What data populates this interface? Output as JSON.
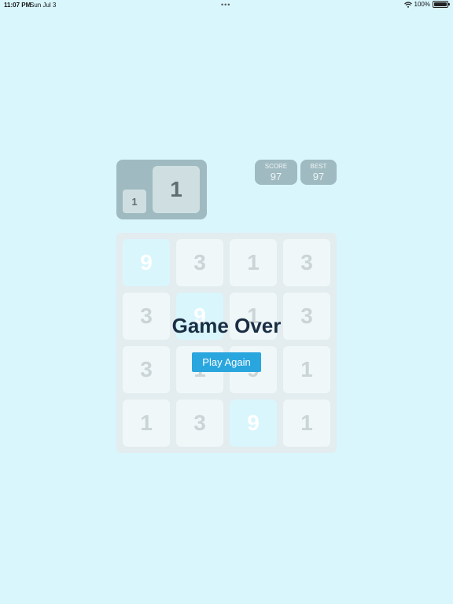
{
  "status_bar": {
    "time": "11:07 PM",
    "date": "Sun Jul 3",
    "battery": "100%",
    "multitask_dots": "•••"
  },
  "next_tiles": {
    "small": "1",
    "big": "1"
  },
  "score": {
    "label": "SCORE",
    "value": "97"
  },
  "best": {
    "label": "BEST",
    "value": "97"
  },
  "board": {
    "rows": [
      [
        {
          "v": "9",
          "hi": true
        },
        {
          "v": "3",
          "hi": false
        },
        {
          "v": "1",
          "hi": false
        },
        {
          "v": "3",
          "hi": false
        }
      ],
      [
        {
          "v": "3",
          "hi": false
        },
        {
          "v": "9",
          "hi": true
        },
        {
          "v": "1",
          "hi": false
        },
        {
          "v": "3",
          "hi": false
        }
      ],
      [
        {
          "v": "3",
          "hi": false
        },
        {
          "v": "1",
          "hi": false
        },
        {
          "v": "9",
          "hi": false
        },
        {
          "v": "1",
          "hi": false
        }
      ],
      [
        {
          "v": "1",
          "hi": false
        },
        {
          "v": "3",
          "hi": false
        },
        {
          "v": "9",
          "hi": true
        },
        {
          "v": "1",
          "hi": false
        }
      ]
    ]
  },
  "game_over": {
    "title": "Game Over",
    "play_again_label": "Play Again"
  },
  "colors": {
    "background": "#d9f6fd",
    "panel": "#9fbac0",
    "accent_button": "#2aa6df",
    "title_text": "#1a2e44"
  }
}
